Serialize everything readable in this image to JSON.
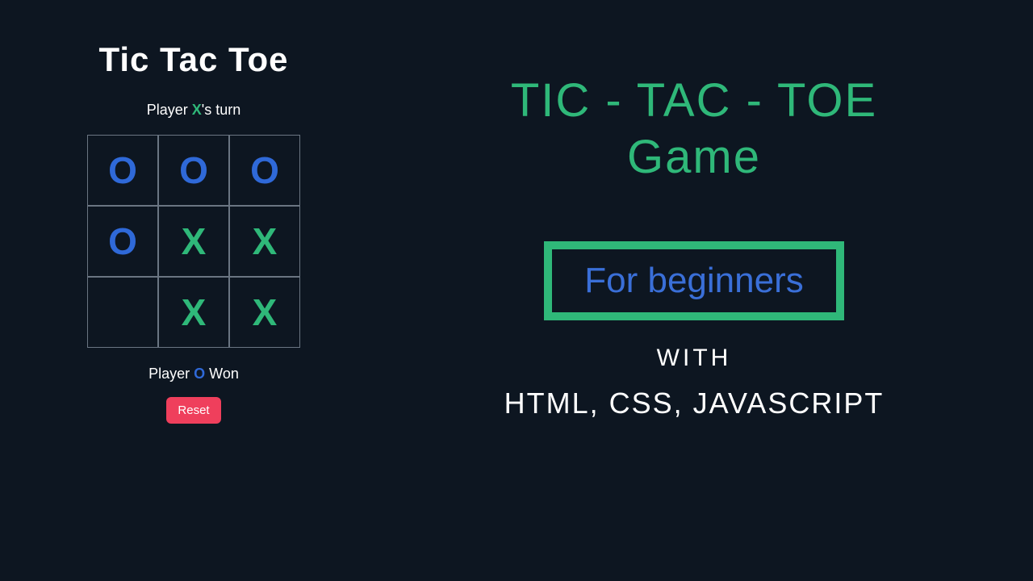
{
  "game": {
    "title": "Tic Tac Toe",
    "turn_prefix": "Player ",
    "turn_player": "X",
    "turn_suffix": "'s turn",
    "board": [
      [
        "O",
        "O",
        "O"
      ],
      [
        "O",
        "X",
        "X"
      ],
      [
        "",
        "X",
        "X"
      ]
    ],
    "result_prefix": "Player ",
    "result_player": "O",
    "result_suffix": " Won",
    "reset_label": "Reset"
  },
  "promo": {
    "title_line1": "TIC - TAC - TOE",
    "title_line2": "Game",
    "beginners": "For beginners",
    "with": "WITH",
    "tech": "HTML, CSS, JAVASCRIPT"
  }
}
